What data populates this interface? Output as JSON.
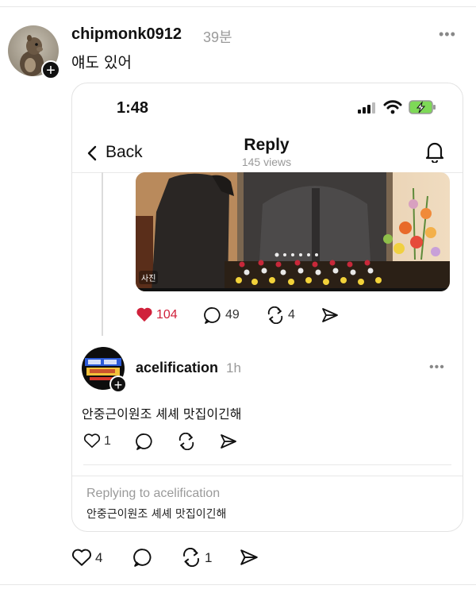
{
  "post": {
    "username": "chipmonk0912",
    "time": "39분",
    "text": "얘도 있어",
    "more_icon": "more-horizontal-icon",
    "actions": {
      "likes": "4",
      "comments": "",
      "reposts": "1"
    }
  },
  "card": {
    "status": {
      "time": "1:48"
    },
    "nav": {
      "back_label": "Back",
      "title": "Reply",
      "views": "145 views"
    },
    "quoted": {
      "media_tag": "사진",
      "likes": "104",
      "comments": "49",
      "reposts": "4"
    },
    "reply": {
      "username": "acelification",
      "time": "1h",
      "text": "안중근이원조 셰셰 맛집이긴해",
      "likes": "1"
    },
    "replying": {
      "label": "Replying to acelification",
      "text": "안중근이원조 셰셰 맛집이긴해"
    }
  },
  "colors": {
    "like_red": "#d0213b",
    "muted": "#9a9a9a",
    "border": "#e3e3e3",
    "battery_green": "#7ed957"
  }
}
